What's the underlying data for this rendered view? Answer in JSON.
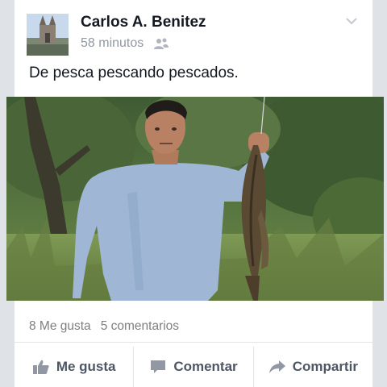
{
  "post": {
    "author": "Carlos A. Benitez",
    "timestamp": "58 minutos",
    "audience_icon": "friends-icon",
    "text": "De pesca pescando pescados."
  },
  "stats": {
    "likes": "8 Me gusta",
    "comments": "5 comentarios"
  },
  "actions": {
    "like": "Me gusta",
    "comment": "Comentar",
    "share": "Compartir"
  },
  "colors": {
    "text_primary": "#141823",
    "text_secondary": "#9197a3",
    "action_text": "#4e5665"
  }
}
